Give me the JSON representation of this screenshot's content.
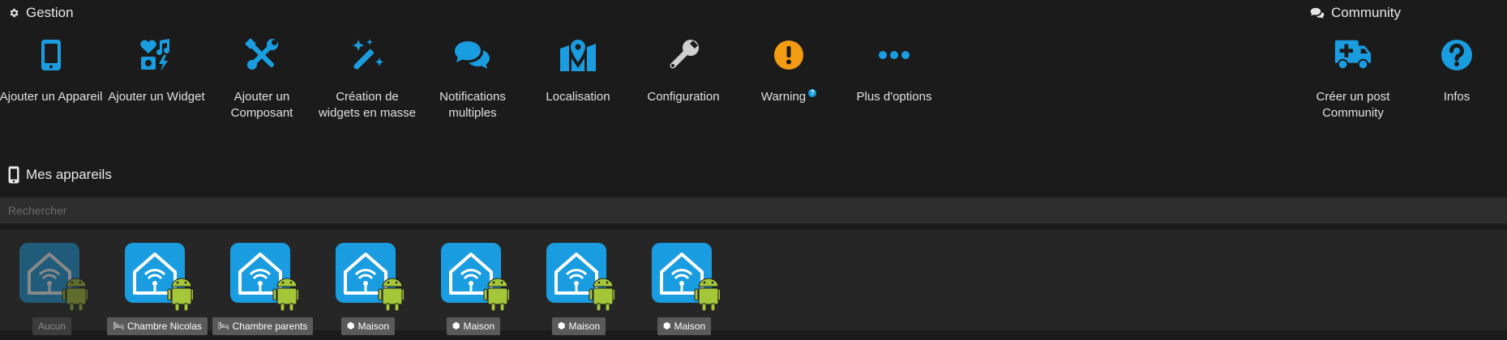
{
  "gestion": {
    "title": "Gestion",
    "actions": [
      {
        "label": "Ajouter un Appareil",
        "icon": "mobile-icon"
      },
      {
        "label": "Ajouter un Widget",
        "icon": "widget-icon"
      },
      {
        "label": "Ajouter un\nComposant",
        "icon": "tools-icon"
      },
      {
        "label": "Création de\nwidgets en masse",
        "icon": "magic-wand-icon"
      },
      {
        "label": "Notifications\nmultiples",
        "icon": "chat-bubbles-icon"
      },
      {
        "label": "Localisation",
        "icon": "map-pin-icon"
      },
      {
        "label": "Configuration",
        "icon": "wrench-icon"
      },
      {
        "label": "Warning",
        "icon": "warning-icon"
      },
      {
        "label": "Plus d'options",
        "icon": "more-dots-icon"
      }
    ]
  },
  "community": {
    "title": "Community",
    "actions": [
      {
        "label": "Créer un post\nCommunity",
        "icon": "ambulance-icon"
      },
      {
        "label": "Infos",
        "icon": "question-circle-icon"
      }
    ]
  },
  "devices_section": {
    "title": "Mes appareils",
    "search_placeholder": "Rechercher",
    "devices": [
      {
        "label": "Aucun",
        "room_icon": "",
        "faded": true
      },
      {
        "label": "Chambre Nicolas",
        "room_icon": "bed-icon",
        "faded": false
      },
      {
        "label": "Chambre parents",
        "room_icon": "bed-icon",
        "faded": false
      },
      {
        "label": "Maison",
        "room_icon": "cube-icon",
        "faded": false
      },
      {
        "label": "Maison",
        "room_icon": "cube-icon",
        "faded": false
      },
      {
        "label": "Maison",
        "room_icon": "cube-icon",
        "faded": false
      },
      {
        "label": "Maison",
        "room_icon": "cube-icon",
        "faded": false
      }
    ]
  },
  "colors": {
    "background": "#1b1b1b",
    "accent_blue": "#1a9de0",
    "warning_orange": "#f39c12",
    "grey_icon": "#cfcfcf",
    "android_green": "#a4c639"
  }
}
